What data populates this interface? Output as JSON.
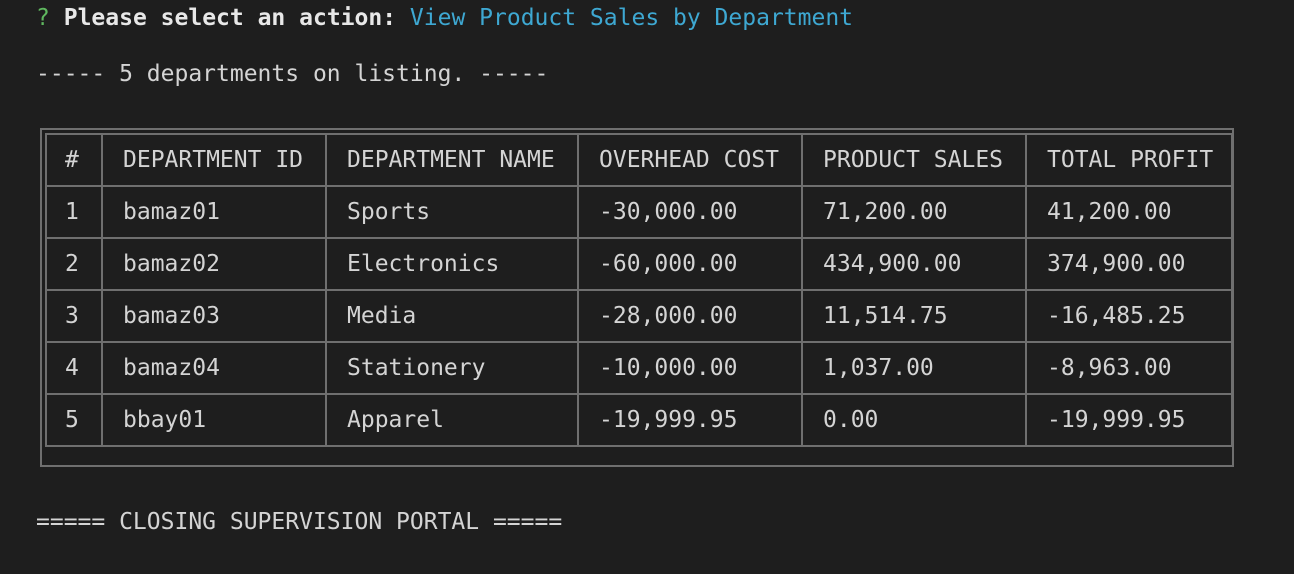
{
  "prompt": {
    "marker": "?",
    "label": "Please select an action:",
    "answer": "View Product Sales by Department"
  },
  "listing": {
    "text": "----- 5 departments on listing. -----"
  },
  "table": {
    "headers": [
      "#",
      "DEPARTMENT ID",
      "DEPARTMENT NAME",
      "OVERHEAD COST",
      "PRODUCT SALES",
      "TOTAL PROFIT"
    ],
    "rows": [
      [
        "1",
        "bamaz01",
        "Sports",
        "-30,000.00",
        "71,200.00",
        "41,200.00"
      ],
      [
        "2",
        "bamaz02",
        "Electronics",
        "-60,000.00",
        "434,900.00",
        "374,900.00"
      ],
      [
        "3",
        "bamaz03",
        "Media",
        "-28,000.00",
        "11,514.75",
        "-16,485.25"
      ],
      [
        "4",
        "bamaz04",
        "Stationery",
        "-10,000.00",
        "1,037.00",
        "-8,963.00"
      ],
      [
        "5",
        "bbay01",
        "Apparel",
        "-19,999.95",
        "0.00",
        "-19,999.95"
      ]
    ]
  },
  "closing": {
    "text": "===== CLOSING SUPERVISION PORTAL ====="
  },
  "colors": {
    "background": "#1e1e1e",
    "text": "#d4d4d4",
    "prompt_marker": "#5fb85f",
    "prompt_answer": "#3ea8d2",
    "table_border": "#6f6f6f"
  }
}
